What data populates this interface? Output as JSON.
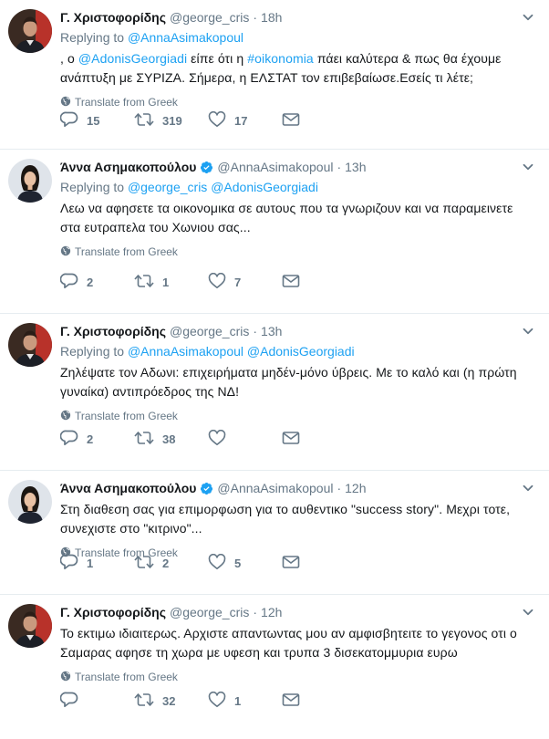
{
  "tweets": [
    {
      "name": "Γ. Χριστοφορίδης",
      "verified": false,
      "handle": "@george_cris",
      "time": "18h",
      "replying_label": "Replying to",
      "replying_to": [
        "@AnnaAsimakopoul"
      ],
      "text_parts": [
        ", ο ",
        "@AdonisGeorgiadi",
        " είπε ότι η ",
        "#οikonomia",
        " πάει καλύτερα & πως θα έχουμε ανάπτυξη με ΣΥΡΙΖΑ. Σήμερα, η ΕΛΣΤΑΤ τον επιβεβαίωσε.Εσείς τι λέτε;"
      ],
      "translate": "Translate from Greek",
      "replies": "15",
      "retweets": "319",
      "likes": "17",
      "dm": true
    },
    {
      "name": "Άννα Ασημακοπούλου",
      "verified": true,
      "handle": "@AnnaAsimakopoul",
      "time": "13h",
      "replying_label": "Replying to",
      "replying_to": [
        "@george_cris",
        "@AdonisGeorgiadi"
      ],
      "text": "Λεω να αφησετε τα οικονομικα σε αυτους που τα γνωριζουν και να παραμεινετε στα ευτραπελα του Χωνιου σας...",
      "translate": "Translate from Greek",
      "replies": "2",
      "retweets": "1",
      "likes": "7",
      "dm": true
    },
    {
      "name": "Γ. Χριστοφορίδης",
      "verified": false,
      "handle": "@george_cris",
      "time": "13h",
      "replying_label": "Replying to",
      "replying_to": [
        "@AnnaAsimakopoul",
        "@AdonisGeorgiadi"
      ],
      "text": "Ζηλέψατε τον Αδωνι: επιχειρήματα μηδέν-μόνο ύβρεις. Με το καλό και (η πρώτη γυναίκα) αντιπρόεδρος της ΝΔ!",
      "translate": "Translate from Greek",
      "replies": "2",
      "retweets": "38",
      "likes": "",
      "dm": true
    },
    {
      "name": "Άννα Ασημακοπούλου",
      "verified": true,
      "handle": "@AnnaAsimakopoul",
      "time": "12h",
      "text": "Στη διαθεση σας για επιμορφωση για το αυθεντικο \"success story\". Μεχρι τοτε, συνεχιστε στο \"κιτρινο\"...",
      "translate": "Translate from Greek",
      "replies": "1",
      "retweets": "2",
      "likes": "5",
      "dm": true
    },
    {
      "name": "Γ. Χριστοφορίδης",
      "verified": false,
      "handle": "@george_cris",
      "time": "12h",
      "text": "Το εκτιμω ιδιαιτερως. Αρχιστε απαντωντας μου αν αμφισβητειτε το γεγονος οτι ο Σαμαρας αφησε τη χωρα με υφεση και τρυπα 3 δισεκατομμυρια ευρω",
      "translate": "Translate from Greek",
      "replies": "",
      "retweets": "32",
      "likes": "1",
      "dm": true
    }
  ],
  "colors": {
    "link": "#1da1f2",
    "muted": "#657786",
    "text": "#14171a",
    "border": "#e6ecf0"
  },
  "icons": {
    "reply": "reply-icon",
    "retweet": "retweet-icon",
    "like": "heart-icon",
    "dm": "envelope-icon",
    "globe": "globe-icon",
    "caret": "chevron-down-icon",
    "verified": "verified-badge-icon"
  }
}
